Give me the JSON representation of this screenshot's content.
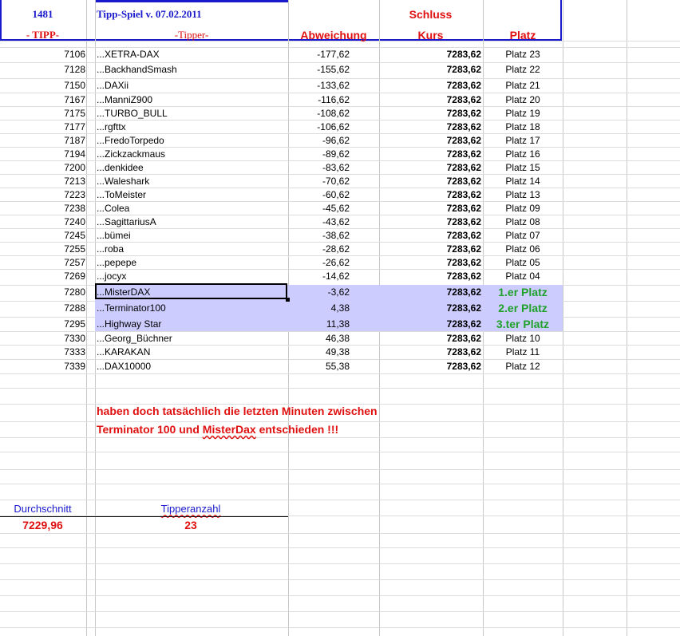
{
  "header": {
    "count": "1481",
    "title": "Tipp-Spiel v. 07.02.2011",
    "schluss": "Schluss",
    "col_tipp": "- TIPP-",
    "col_tipper": "-Tipper-",
    "col_abweichung": "Abweichung",
    "col_kurs": "Kurs",
    "col_platz": "Platz"
  },
  "rows": [
    {
      "tipp": "7106",
      "name": "...XETRA-DAX",
      "dev": "-177,62",
      "kurs": "7283,62",
      "platz": "Platz 23"
    },
    {
      "tipp": "7128",
      "name": "...BackhandSmash",
      "dev": "-155,62",
      "kurs": "7283,62",
      "platz": "Platz 22"
    },
    {
      "tipp": "7150",
      "name": "...DAXii",
      "dev": "-133,62",
      "kurs": "7283,62",
      "platz": "Platz 21"
    },
    {
      "tipp": "7167",
      "name": "...ManniZ900",
      "dev": "-116,62",
      "kurs": "7283,62",
      "platz": "Platz 20"
    },
    {
      "tipp": "7175",
      "name": "...TURBO_BULL",
      "dev": "-108,62",
      "kurs": "7283,62",
      "platz": "Platz 19"
    },
    {
      "tipp": "7177",
      "name": "...rgfttx",
      "dev": "-106,62",
      "kurs": "7283,62",
      "platz": "Platz 18"
    },
    {
      "tipp": "7187",
      "name": "...FredoTorpedo",
      "dev": "-96,62",
      "kurs": "7283,62",
      "platz": "Platz 17"
    },
    {
      "tipp": "7194",
      "name": "...Zickzackmaus",
      "dev": "-89,62",
      "kurs": "7283,62",
      "platz": "Platz 16"
    },
    {
      "tipp": "7200",
      "name": "...denkidee",
      "dev": "-83,62",
      "kurs": "7283,62",
      "platz": "Platz 15"
    },
    {
      "tipp": "7213",
      "name": "...Waleshark",
      "dev": "-70,62",
      "kurs": "7283,62",
      "platz": "Platz 14"
    },
    {
      "tipp": "7223",
      "name": "...ToMeister",
      "dev": "-60,62",
      "kurs": "7283,62",
      "platz": "Platz 13"
    },
    {
      "tipp": "7238",
      "name": "...Colea",
      "dev": "-45,62",
      "kurs": "7283,62",
      "platz": "Platz 09"
    },
    {
      "tipp": "7240",
      "name": "...SagittariusA",
      "dev": "-43,62",
      "kurs": "7283,62",
      "platz": "Platz 08"
    },
    {
      "tipp": "7245",
      "name": "...bümei",
      "dev": "-38,62",
      "kurs": "7283,62",
      "platz": "Platz 07"
    },
    {
      "tipp": "7255",
      "name": "...roba",
      "dev": "-28,62",
      "kurs": "7283,62",
      "platz": "Platz 06"
    },
    {
      "tipp": "7257",
      "name": "...pepepe",
      "dev": "-26,62",
      "kurs": "7283,62",
      "platz": "Platz 05"
    },
    {
      "tipp": "7269",
      "name": "...jocyx",
      "dev": "-14,62",
      "kurs": "7283,62",
      "platz": "Platz 04"
    },
    {
      "tipp": "7280",
      "name": "...MisterDAX",
      "dev": "-3,62",
      "kurs": "7283,62",
      "platz": "1.er Platz"
    },
    {
      "tipp": "7288",
      "name": "...Terminator100",
      "dev": "4,38",
      "kurs": "7283,62",
      "platz": "2.er Platz"
    },
    {
      "tipp": "7295",
      "name": "...Highway Star",
      "dev": "11,38",
      "kurs": "7283,62",
      "platz": "3.ter Platz"
    },
    {
      "tipp": "7330",
      "name": "...Georg_Büchner",
      "dev": "46,38",
      "kurs": "7283,62",
      "platz": "Platz 10"
    },
    {
      "tipp": "7333",
      "name": "...KARAKAN",
      "dev": "49,38",
      "kurs": "7283,62",
      "platz": "Platz 11"
    },
    {
      "tipp": "7339",
      "name": "...DAX10000",
      "dev": "55,38",
      "kurs": "7283,62",
      "platz": "Platz 12"
    }
  ],
  "comment": {
    "line1": "haben doch tatsächlich die letzten Minuten zwischen",
    "line2_a": "Terminator 100 und ",
    "line2_b": "MisterDax",
    "line2_c": " entschieden !!!"
  },
  "summary": {
    "avg_label": "Durchschnitt",
    "avg_value": "7229,96",
    "count_label": "Tipperanzahl",
    "count_value": "23"
  },
  "colors": {
    "header_blue": "#1a1acc",
    "accent_red": "#e01010",
    "winner_green": "#1fa12a",
    "highlight_band": "#ccccff"
  }
}
